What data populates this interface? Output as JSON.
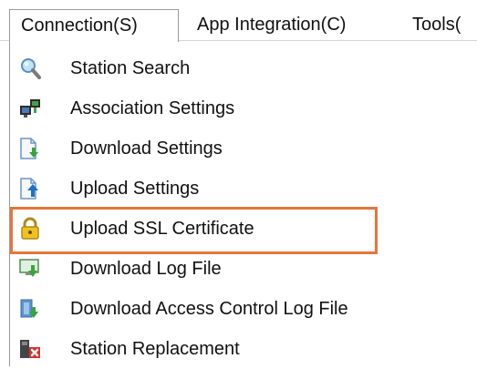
{
  "menubar": {
    "items": [
      {
        "label": "Connection(S)"
      },
      {
        "label": "App Integration(C)"
      },
      {
        "label": "Tools("
      }
    ]
  },
  "dropdown": {
    "items": [
      {
        "label": "Station Search",
        "icon": "magnifier-icon"
      },
      {
        "label": "Association Settings",
        "icon": "computers-link-icon"
      },
      {
        "label": "Download Settings",
        "icon": "document-download-icon"
      },
      {
        "label": "Upload Settings",
        "icon": "document-upload-icon"
      },
      {
        "label": "Upload SSL Certificate",
        "icon": "padlock-icon"
      },
      {
        "label": "Download Log File",
        "icon": "monitor-download-icon"
      },
      {
        "label": "Download Access Control Log File",
        "icon": "access-log-download-icon"
      },
      {
        "label": "Station Replacement",
        "icon": "station-replace-icon"
      }
    ],
    "highlighted_item": "Upload Settings"
  },
  "colors": {
    "highlight_border": "#e8743b",
    "menu_border": "#9a9a9a"
  }
}
